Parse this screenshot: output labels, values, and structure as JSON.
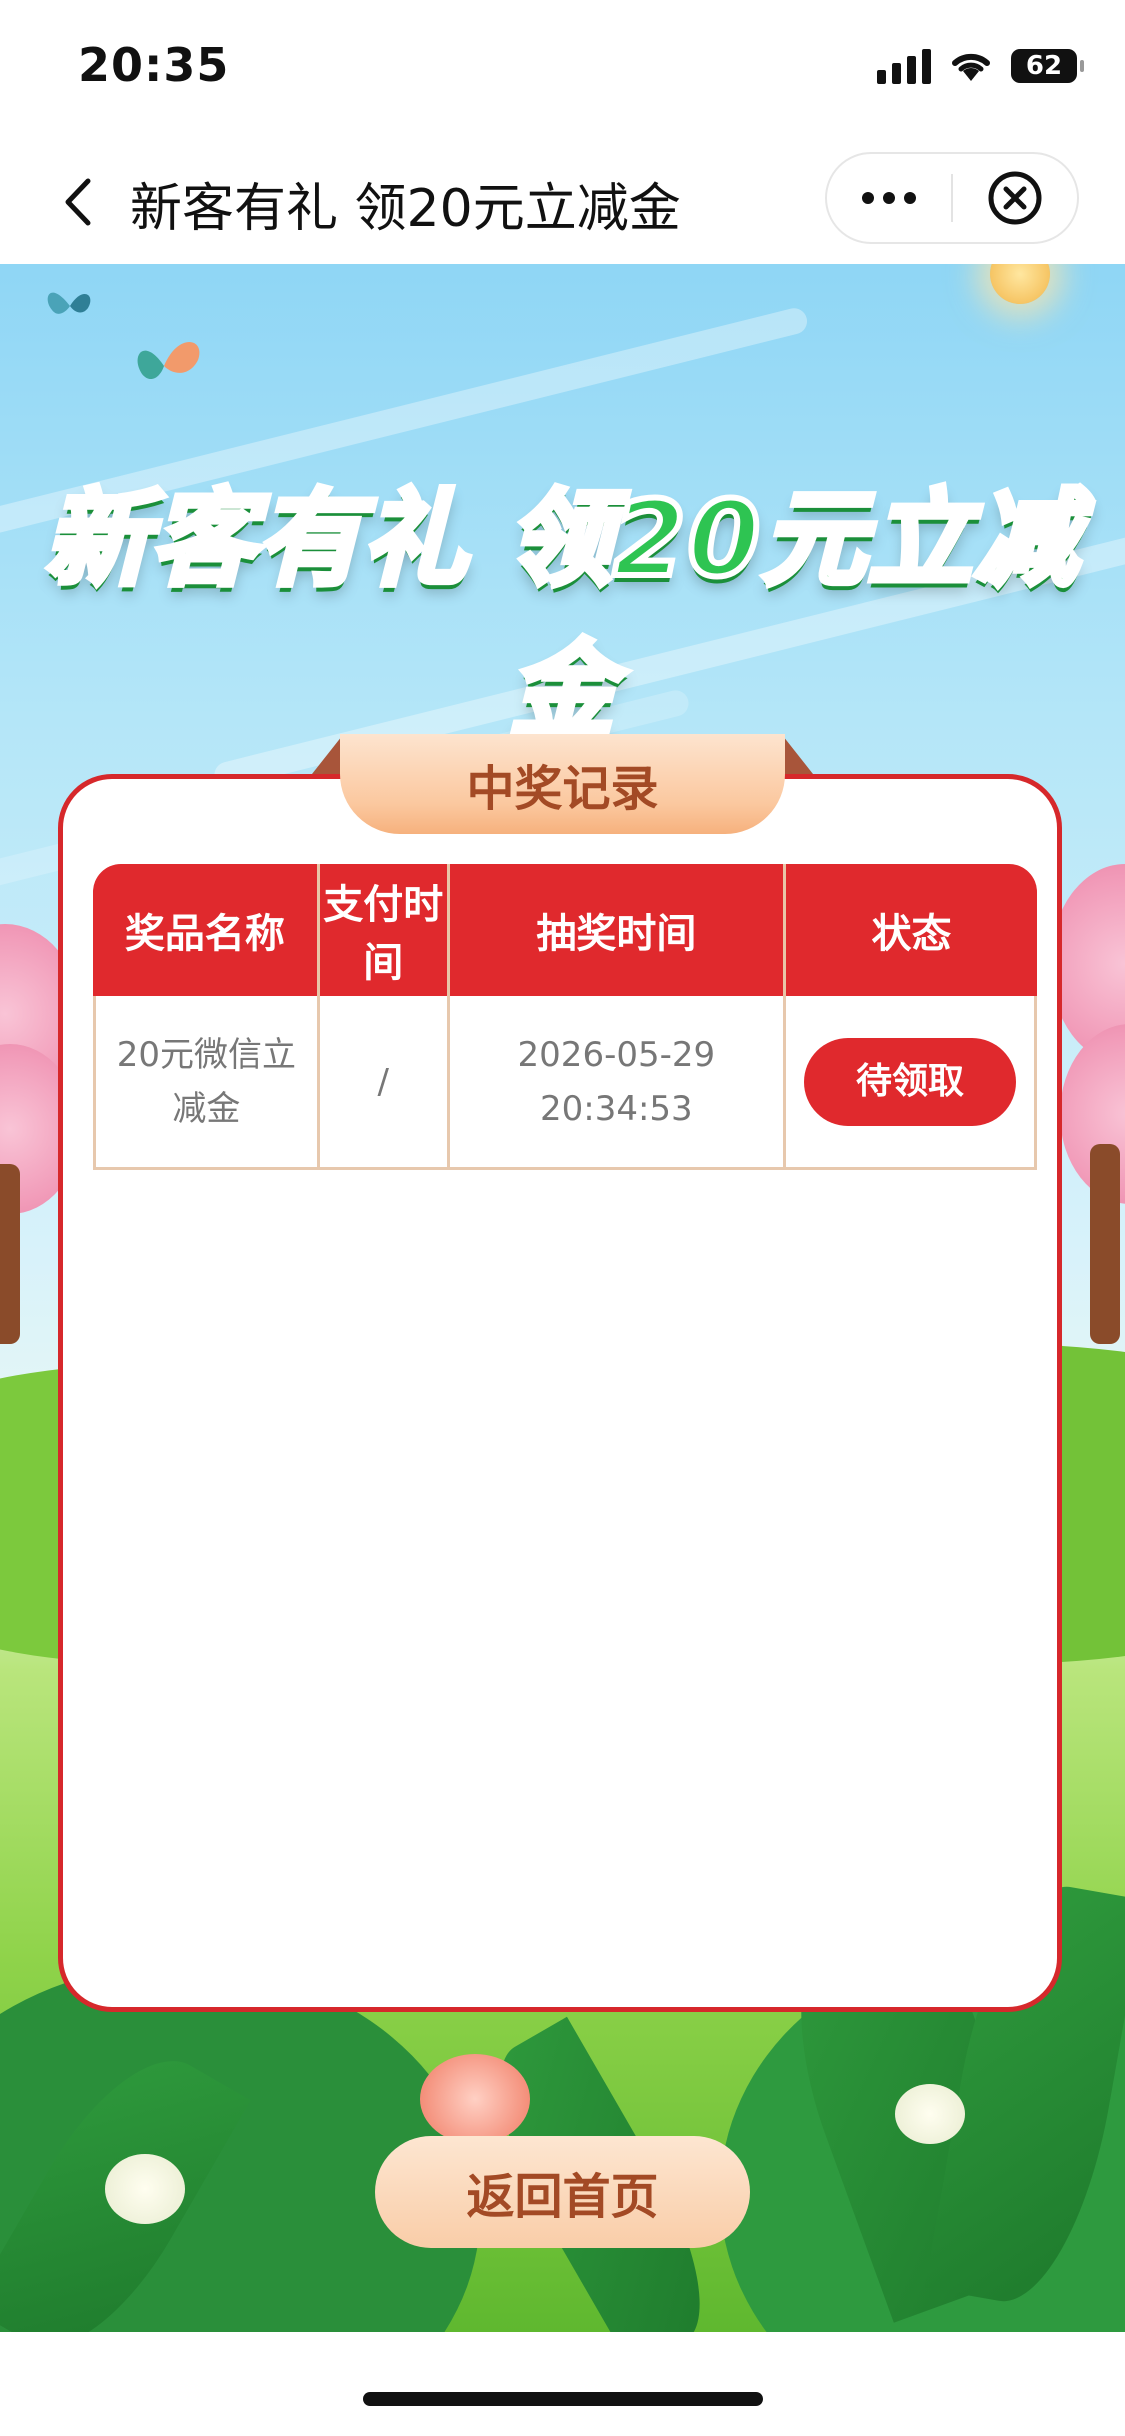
{
  "status_bar": {
    "time": "20:35",
    "battery": "62"
  },
  "nav": {
    "title": "新客有礼 领20元立减金"
  },
  "banner": {
    "headline": "新客有礼 领20元立减金"
  },
  "card": {
    "tab_title": "中奖记录",
    "columns": [
      "奖品名称",
      "支付时间",
      "抽奖时间",
      "状态"
    ],
    "rows": [
      {
        "prize": "20元微信立减金",
        "pay_time": "/",
        "draw_time": "2026-05-29 20:34:53",
        "status": "待领取"
      }
    ]
  },
  "footer": {
    "home_button": "返回首页"
  },
  "colors": {
    "accent": "#e0292d",
    "tab": "#f9cda8",
    "title_green": "#2ec452"
  },
  "icons": [
    "back-arrow-icon",
    "more-dots-icon",
    "close-circle-icon",
    "signal-icon",
    "wifi-icon",
    "battery-icon",
    "butterfly-icon"
  ]
}
